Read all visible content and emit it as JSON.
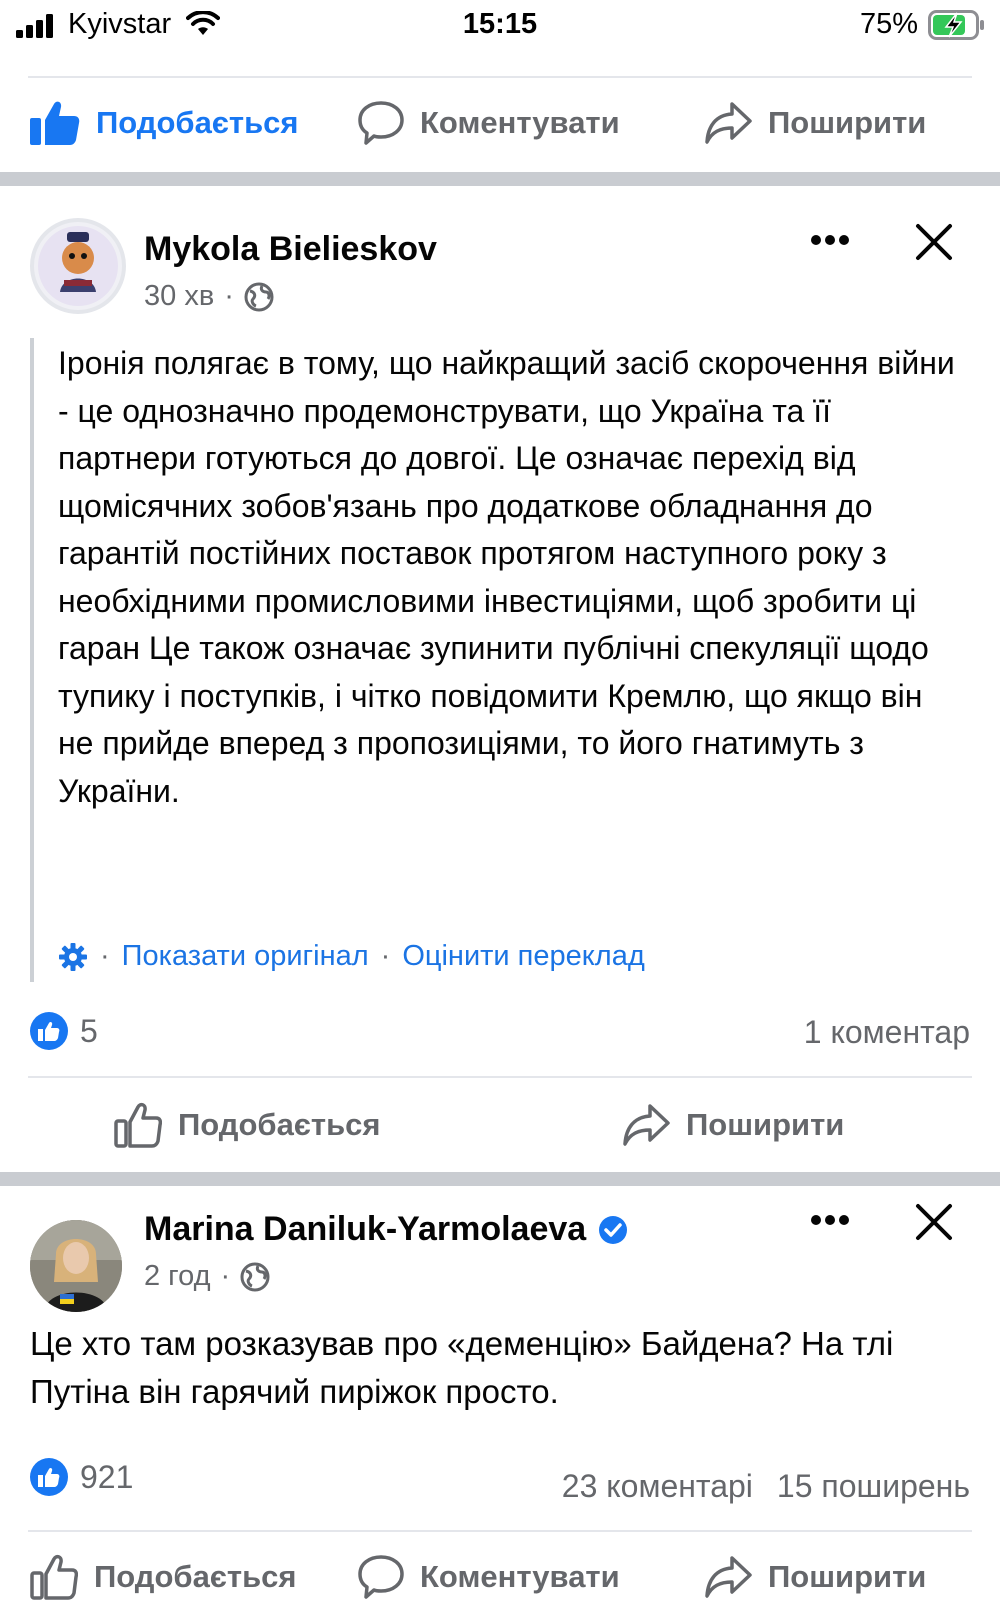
{
  "status_bar": {
    "carrier": "Kyivstar",
    "time": "15:15",
    "battery": "75%"
  },
  "top_actions": {
    "like": "Подобається",
    "comment": "Коментувати",
    "share": "Поширити"
  },
  "post1": {
    "author": "Mykola Bielieskov",
    "time": "30 хв",
    "separator": "·",
    "text": "Іронія полягає в тому, що найкращий засіб скорочення війни - це однозначно продемонструвати, що Україна та її партнери готуються до довгої. Це означає перехід від щомісячних зобов'язань про додаткове обладнання до гарантій постійних поставок протягом наступного року з необхідними промисловими інвестиціями, щоб зробити ці гаран Це також означає зупинити публічні спекуляції щодо тупику і поступків, і чітко повідомити Кремлю, що якщо він не прийде вперед з пропозиціями, то його гнатимуть з України.",
    "show_original": "Показати оригінал",
    "rate_translation": "Оцінити переклад",
    "dot": "·",
    "reactions": "5",
    "comments": "1 коментар",
    "actions": {
      "like": "Подобається",
      "share": "Поширити"
    }
  },
  "post2": {
    "author": "Marina Daniluk-Yarmolaeva",
    "time": "2 год",
    "separator": "·",
    "text": "Це хто там розказував про «деменцію» Байдена? На тлі Путіна він гарячий пиріжок просто.",
    "reactions": "921",
    "comments": "23 коментарі",
    "shares": "15 поширень",
    "actions": {
      "like": "Подобається",
      "comment": "Коментувати",
      "share": "Поширити"
    }
  },
  "colors": {
    "accent": "#1877f2",
    "link": "#1b74e4",
    "muted": "#65676b",
    "separator": "#c9ccd1",
    "battery_charge": "#34c759"
  },
  "icons": [
    "signal-icon",
    "wifi-icon",
    "battery-icon",
    "thumbs-up-icon",
    "comment-icon",
    "share-icon",
    "more-icon",
    "close-icon",
    "globe-icon",
    "gear-icon",
    "verified-icon"
  ]
}
